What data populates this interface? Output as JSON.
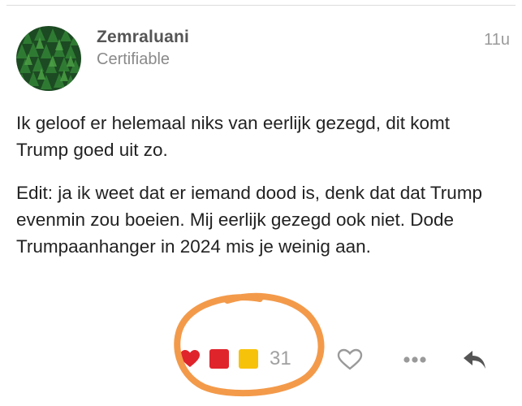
{
  "post": {
    "username": "Zemraluani",
    "user_title": "Certifiable",
    "timestamp": "11u",
    "paragraphs": [
      "Ik geloof er helemaal niks van eerlijk gezegd, dit komt Trump goed uit zo.",
      "Edit: ja ik weet dat er iemand dood is, denk dat dat Trump evenmin zou boeien. Mij eerlijk gezegd ook niet. Dode Trumpaanhanger in 2024 mis je weinig aan."
    ]
  },
  "reactions": {
    "items": [
      {
        "icon": "heart-icon",
        "color": "#e0242c"
      },
      {
        "icon": "red-square-icon",
        "color": "#e0242c"
      },
      {
        "icon": "yellow-square-icon",
        "color": "#f7c20a"
      }
    ],
    "count": "31"
  },
  "actions": {
    "like_icon": "heart-outline-icon",
    "more_icon": "ellipsis-icon",
    "reply_icon": "reply-arrow-icon"
  },
  "annotation": {
    "shape": "hand-drawn circle around reactions",
    "color": "#f39a4a"
  }
}
